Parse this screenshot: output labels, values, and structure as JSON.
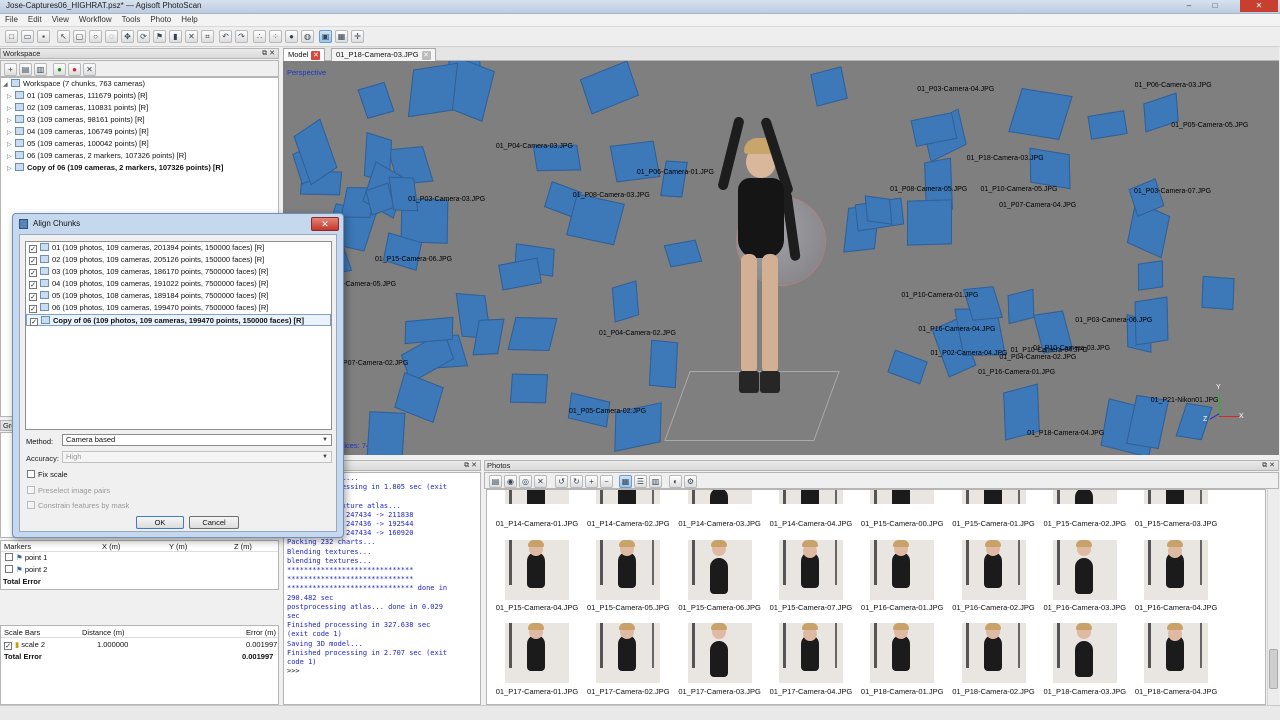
{
  "window": {
    "title": "Jose-Captures06_HIGHRAT.psz* — Agisoft PhotoScan",
    "minimize": "–",
    "maximize": "□",
    "close": "✕"
  },
  "menu": [
    "File",
    "Edit",
    "View",
    "Workflow",
    "Tools",
    "Photo",
    "Help"
  ],
  "workspace": {
    "title": "Workspace",
    "root": "Workspace (7 chunks, 763 cameras)",
    "chunks": [
      "01 (109 cameras, 111679 points) [R]",
      "02 (109 cameras, 110831 points) [R]",
      "03 (109 cameras, 98161 points) [R]",
      "04 (109 cameras, 106749 points) [R]",
      "05 (109 cameras, 100042 points) [R]",
      "06 (109 cameras, 2 markers, 107326 points) [R]",
      "Copy of 06 (109 cameras, 2 markers, 107326 points) [R]"
    ]
  },
  "ground": {
    "title": "Gro"
  },
  "markers": {
    "header": [
      "Markers",
      "X (m)",
      "Y (m)",
      "Z (m)"
    ],
    "items": [
      "point 1",
      "point 2"
    ],
    "total": "Total Error"
  },
  "scalebars": {
    "header": [
      "Scale Bars",
      "Distance (m)",
      "Error (m)"
    ],
    "rows": [
      {
        "name": "scale 2",
        "distance": "1.000000",
        "error": "0.001997"
      }
    ],
    "total_label": "Total Error",
    "total_value": "0.001997"
  },
  "tabs": {
    "model": "Model",
    "photo": "01_P18-Camera-03.JPG"
  },
  "viewport": {
    "mode": "Perspective",
    "stats": "Vertices: 74953",
    "axes": [
      "Y",
      "Z",
      "X"
    ]
  },
  "camera_labels": [
    "01_P15-Camera-06.JPG",
    "01_P15-Camera-05.JPG",
    "01_P16-Camera-04.JPG",
    "01_P03-Camera-07.JPG",
    "01_P03-Camera-06.JPG",
    "01_P03-Camera-04.JPG",
    "01_P03-Camera-03.JPG",
    "01_P02-Camera-04.JPG",
    "01_P04-Camera-02.JPG",
    "01_P21-Nikon01.JPG",
    "01_P04-Camera-03.JPG",
    "01_P08-Camera-05.JPG",
    "01_P07-Camera-04.JPG",
    "01_P06-Camera-01.JPG",
    "01_P05-Camera-02.JPG",
    "01_P06-Camera-03.JPG",
    "01_P08-Camera-03.JPG",
    "01_P18-Camera-04.JPG",
    "01_P18-Camera-03.JPG",
    "01_P04-Camera-02.JPG",
    "01_P16-Camera-01.JPG",
    "01_P10-Camera-05.JPG",
    "01_P10-Camera-04.JPG",
    "01_P10-Camera-03.JPG",
    "01_P10-Camera-01.JPG",
    "01_P07-Camera-02.JPG",
    "01_P05-Camera-05.JPG"
  ],
  "dialog": {
    "title": "Align Chunks",
    "items": [
      "01 (109 photos, 109 cameras, 201394 points, 150000 faces) [R]",
      "02 (109 photos, 109 cameras, 205126 points, 150000 faces) [R]",
      "03 (109 photos, 109 cameras, 186170 points, 7500000 faces) [R]",
      "04 (109 photos, 109 cameras, 191022 points, 7500000 faces) [R]",
      "05 (109 photos, 108 cameras, 189184 points, 7500000 faces) [R]",
      "06 (109 photos, 109 cameras, 199470 points, 7500000 faces) [R]",
      "Copy of 06 (109 photos, 109 cameras, 199470 points, 150000 faces) [R]"
    ],
    "method_label": "Method:",
    "method_value": "Camera based",
    "accuracy_label": "Accuracy:",
    "accuracy_value": "High",
    "fix_scale": "Fix scale",
    "preselect": "Preselect image pairs",
    "constrain": "Constrain features by mask",
    "ok": "OK",
    "cancel": "Cancel"
  },
  "console": {
    "lines": [
      "ooooooooooodel...",
      "Finished processing in 1.805 sec (exit",
      "code 1)",
      "processing texture atlas...",
      "heap cleanup: 247434 -> 211838",
      "heap cleanup: 247436 -> 192544",
      "heap cleanup: 247434 -> 160920",
      "Packing 232 charts...",
      "Blending textures...",
      "blending textures...",
      "******************************",
      "******************************",
      "****************************** done in",
      "290.482 sec",
      "postprocessing atlas... done in 0.029",
      "sec",
      "Finished processing in 327.638 sec",
      "(exit code 1)",
      "Saving 3D model...",
      "Finished processing in 2.707 sec (exit",
      "code 1)",
      ">>>"
    ]
  },
  "photos": {
    "title": "Photos",
    "rows": [
      [
        "01_P14-Camera-01.JPG",
        "01_P14-Camera-02.JPG",
        "01_P14-Camera-03.JPG",
        "01_P14-Camera-04.JPG",
        "01_P15-Camera-00.JPG",
        "01_P15-Camera-01.JPG",
        "01_P15-Camera-02.JPG",
        "01_P15-Camera-03.JPG"
      ],
      [
        "01_P15-Camera-04.JPG",
        "01_P15-Camera-05.JPG",
        "01_P15-Camera-06.JPG",
        "01_P15-Camera-07.JPG",
        "01_P16-Camera-01.JPG",
        "01_P16-Camera-02.JPG",
        "01_P16-Camera-03.JPG",
        "01_P16-Camera-04.JPG"
      ],
      [
        "01_P17-Camera-01.JPG",
        "01_P17-Camera-02.JPG",
        "01_P17-Camera-03.JPG",
        "01_P17-Camera-04.JPG",
        "01_P18-Camera-01.JPG",
        "01_P18-Camera-02.JPG",
        "01_P18-Camera-03.JPG",
        "01_P18-Camera-04.JPG"
      ]
    ]
  },
  "panel_controls": {
    "float": "⧉",
    "close": "✕"
  }
}
